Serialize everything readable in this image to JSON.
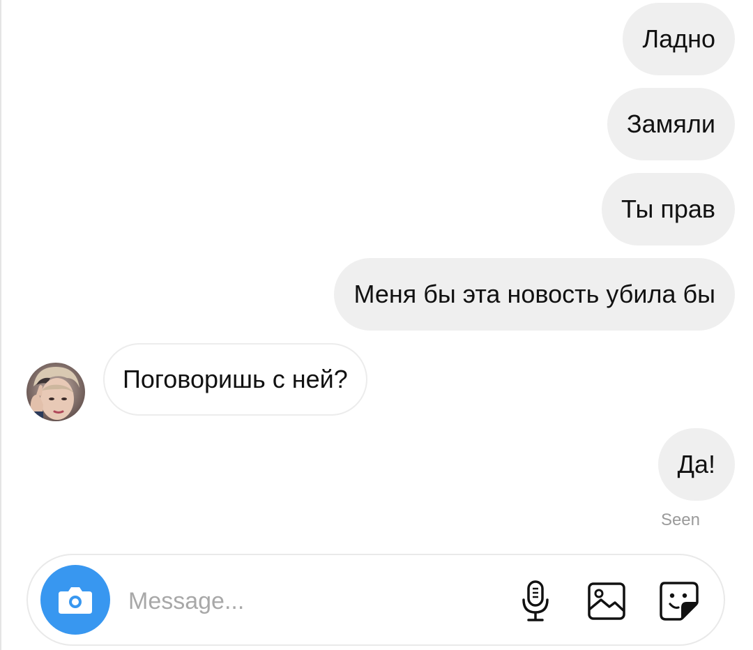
{
  "conversation": {
    "messages": [
      {
        "side": "outgoing",
        "text": "Ладно"
      },
      {
        "side": "outgoing",
        "text": "Замяли"
      },
      {
        "side": "outgoing",
        "text": "Ты прав"
      },
      {
        "side": "outgoing",
        "text": "Меня бы эта новость убила бы"
      },
      {
        "side": "incoming",
        "text": "Поговоришь с ней?"
      },
      {
        "side": "outgoing",
        "text": "Да!"
      }
    ],
    "seen_label": "Seen"
  },
  "composer": {
    "placeholder": "Message...",
    "value": "",
    "icons": {
      "camera": "camera-icon",
      "microphone": "microphone-icon",
      "gallery": "gallery-icon",
      "sticker": "sticker-icon"
    },
    "accent_color": "#3897f0"
  },
  "colors": {
    "outgoing_bubble": "#efefef",
    "incoming_border": "#ececec",
    "seen_text": "#9a9a9a"
  }
}
